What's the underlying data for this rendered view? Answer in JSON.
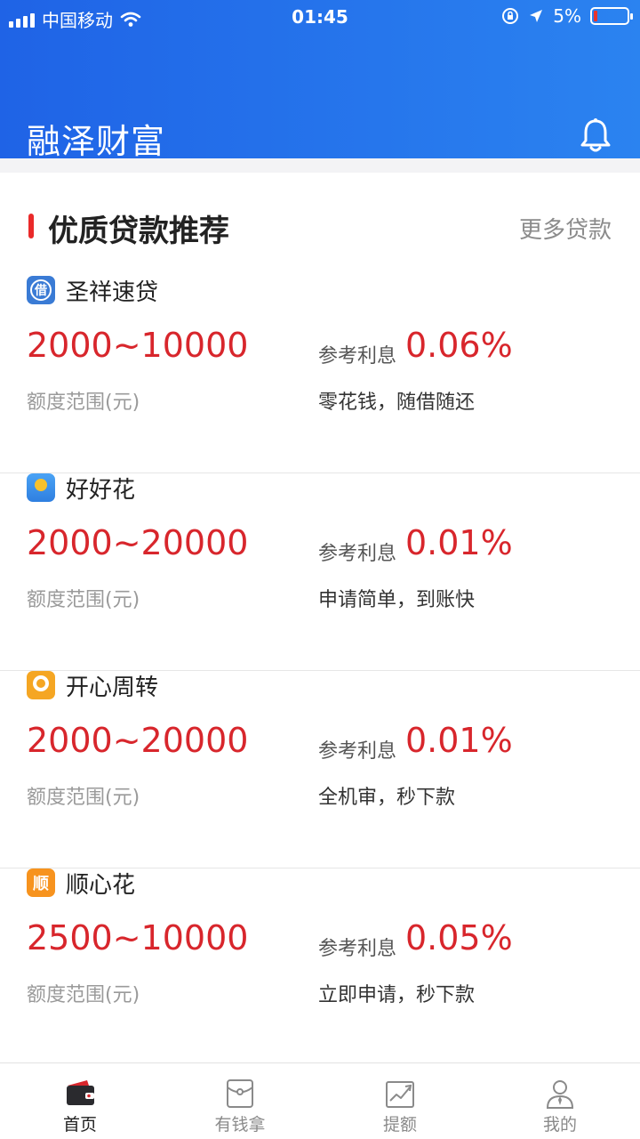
{
  "status_bar": {
    "carrier": "中国移动",
    "time": "01:45",
    "battery": "5%"
  },
  "app": {
    "title": "融泽财富"
  },
  "section": {
    "title": "优质贷款推荐",
    "more": "更多贷款"
  },
  "loans": [
    {
      "name": "圣祥速贷",
      "logo_text": "借",
      "logo_color": "#3a7bd5",
      "range": "2000~10000",
      "range_label": "额度范围(元)",
      "rate_label": "参考利息",
      "rate": "0.06%",
      "feature": "零花钱，随借随还"
    },
    {
      "name": "好好花",
      "logo_text": "",
      "logo_color": "#2f86e8",
      "range": "2000~20000",
      "range_label": "额度范围(元)",
      "rate_label": "参考利息",
      "rate": "0.01%",
      "feature": "申请简单，到账快"
    },
    {
      "name": "开心周转",
      "logo_text": "",
      "logo_color": "#f5a623",
      "range": "2000~20000",
      "range_label": "额度范围(元)",
      "rate_label": "参考利息",
      "rate": "0.01%",
      "feature": "全机审，秒下款"
    },
    {
      "name": "顺心花",
      "logo_text": "顺",
      "logo_color": "#f7931e",
      "range": "2500~10000",
      "range_label": "额度范围(元)",
      "rate_label": "参考利息",
      "rate": "0.05%",
      "feature": "立即申请，秒下款"
    }
  ],
  "tabs": [
    {
      "label": "首页",
      "icon": "wallet-icon",
      "active": true
    },
    {
      "label": "有钱拿",
      "icon": "envelope-icon",
      "active": false
    },
    {
      "label": "提额",
      "icon": "chart-up-icon",
      "active": false
    },
    {
      "label": "我的",
      "icon": "user-icon",
      "active": false
    }
  ],
  "colors": {
    "header": "#2470ea",
    "accent": "#d8262c",
    "section_bar": "#ea2a2a"
  }
}
